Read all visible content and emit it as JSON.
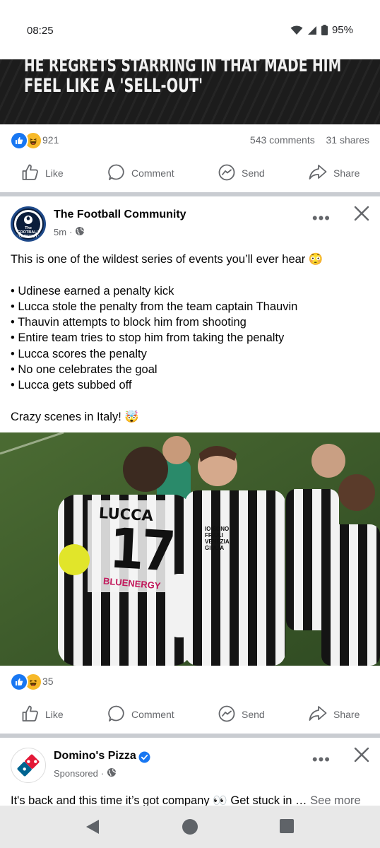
{
  "status_bar": {
    "time": "08:25",
    "battery": "95%"
  },
  "prev_post": {
    "headline_line1": "HE REGRETS STARRING IN THAT MADE HIM",
    "headline_line2": "FEEL LIKE A 'SELL-OUT'",
    "reaction_count": "921",
    "comments": "543 comments",
    "shares": "31 shares"
  },
  "actions": {
    "like": "Like",
    "comment": "Comment",
    "send": "Send",
    "share": "Share"
  },
  "post1": {
    "page_name": "The Football Community",
    "avatar_text": "The FOOTBALL COMMUNITY",
    "time": "5m",
    "text": "This is one of the wildest series of events you’ll ever hear 😳\n\n• Udinese earned a penalty kick\n• Lucca stole the penalty from the team captain Thauvin\n• Thauvin attempts to block him from shooting\n• Entire team tries to stop him from taking the penalty\n• Lucca scores the penalty\n• No one celebrates the goal\n• Lucca gets subbed off\n\nCrazy scenes in Italy! 🤯",
    "image": {
      "shirt_name": "LUCCA",
      "shirt_number": "17",
      "sponsor": "BLUENERGY",
      "shirt_text": "IO SONO FRIULI VENEZIA GIULIA"
    },
    "reaction_count": "35"
  },
  "post2": {
    "page_name": "Domino's Pizza",
    "meta": "Sponsored",
    "text": "It's back and this time it’s got company 👀 Get stuck in …",
    "see_more": "See more"
  },
  "colors": {
    "facebook_blue": "#1877f2",
    "haha_yellow": "#f7b928",
    "secondary_text": "#65676b",
    "divider": "#c9ccd1",
    "dominos_blue": "#006491",
    "dominos_red": "#e31837"
  }
}
